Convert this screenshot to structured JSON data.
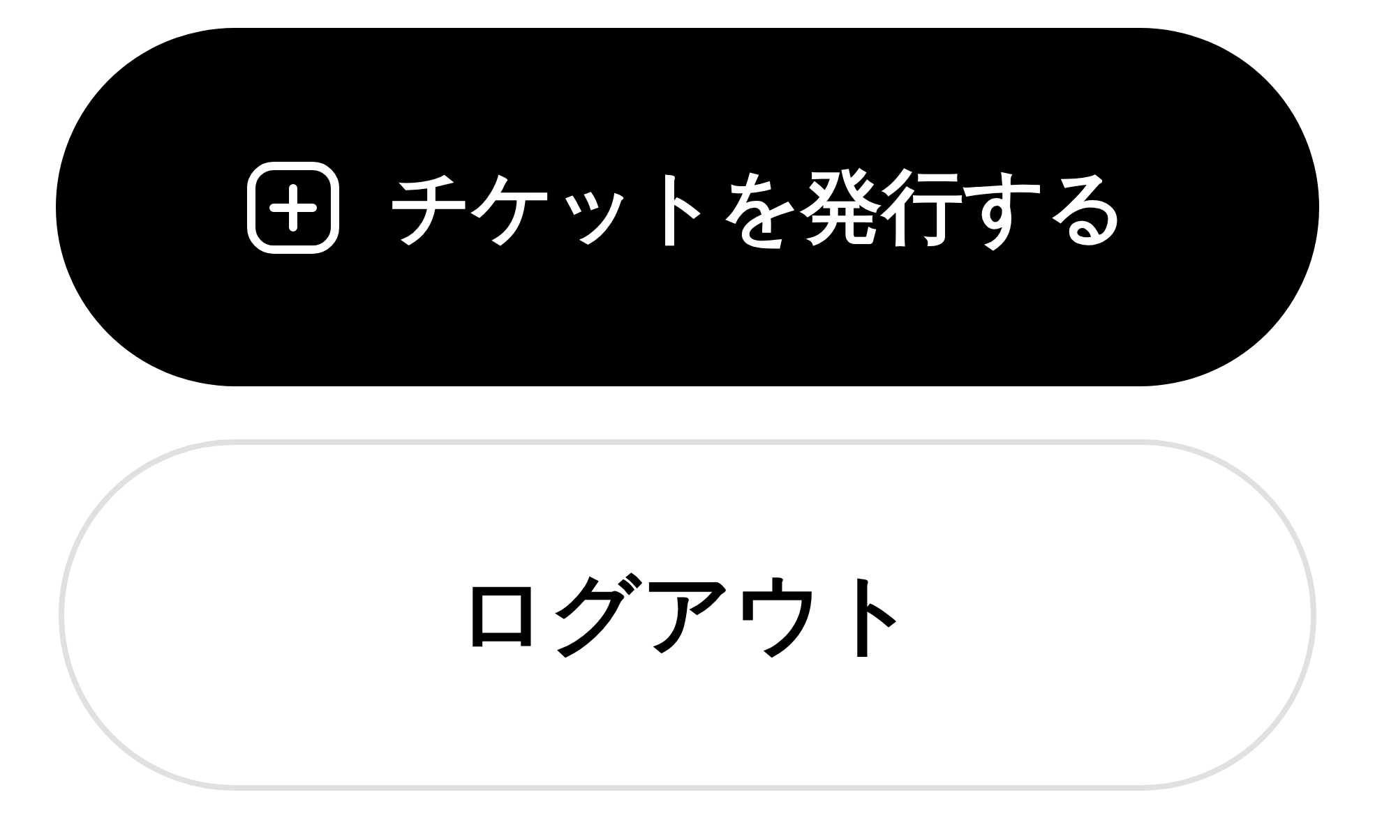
{
  "buttons": [
    {
      "kind": "primary",
      "label": "チケットを発行する"
    },
    {
      "kind": "outline",
      "label": "ログアウト"
    }
  ]
}
